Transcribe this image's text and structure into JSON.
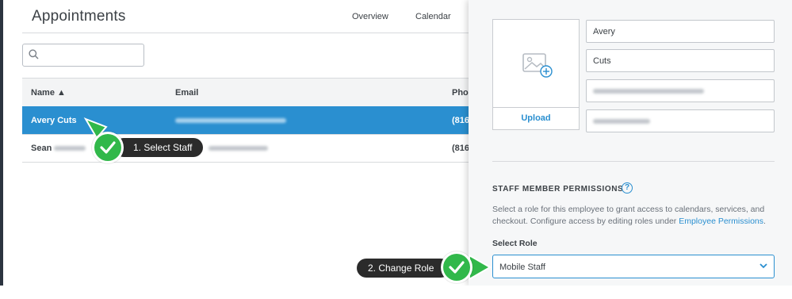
{
  "page": {
    "title": "Appointments"
  },
  "nav": {
    "overview": "Overview",
    "calendar": "Calendar"
  },
  "search": {
    "placeholder": "",
    "value": ""
  },
  "table": {
    "headers": {
      "name": "Name ▲",
      "email": "Email",
      "phone": "Phon"
    },
    "rows": [
      {
        "name": "Avery Cuts",
        "phone": "(816",
        "selected": true
      },
      {
        "name": "Sean",
        "phone": "(816",
        "selected": false
      }
    ]
  },
  "panel": {
    "upload_label": "Upload",
    "fields": {
      "first_name": "Avery",
      "last_name": "Cuts",
      "email": "",
      "phone": ""
    },
    "permissions_title": "STAFF MEMBER PERMISSIONS",
    "help_glyph": "?",
    "description": "Select a role for this employee to grant access to calendars, services, and checkout. Configure access by editing roles under ",
    "description_link": "Employee Permissions",
    "description_end": ".",
    "select_role_label": "Select Role",
    "selected_role": "Mobile Staff"
  },
  "callouts": {
    "step1": "1. Select Staff",
    "step2": "2. Change Role"
  },
  "colors": {
    "accent": "#2a8fd0",
    "success": "#31b84a",
    "callout": "#2b2b2b"
  },
  "icons": {
    "search": "search-icon",
    "add_image": "image-add-icon",
    "chevron": "chevron-down-icon",
    "check": "checkmark-icon"
  }
}
